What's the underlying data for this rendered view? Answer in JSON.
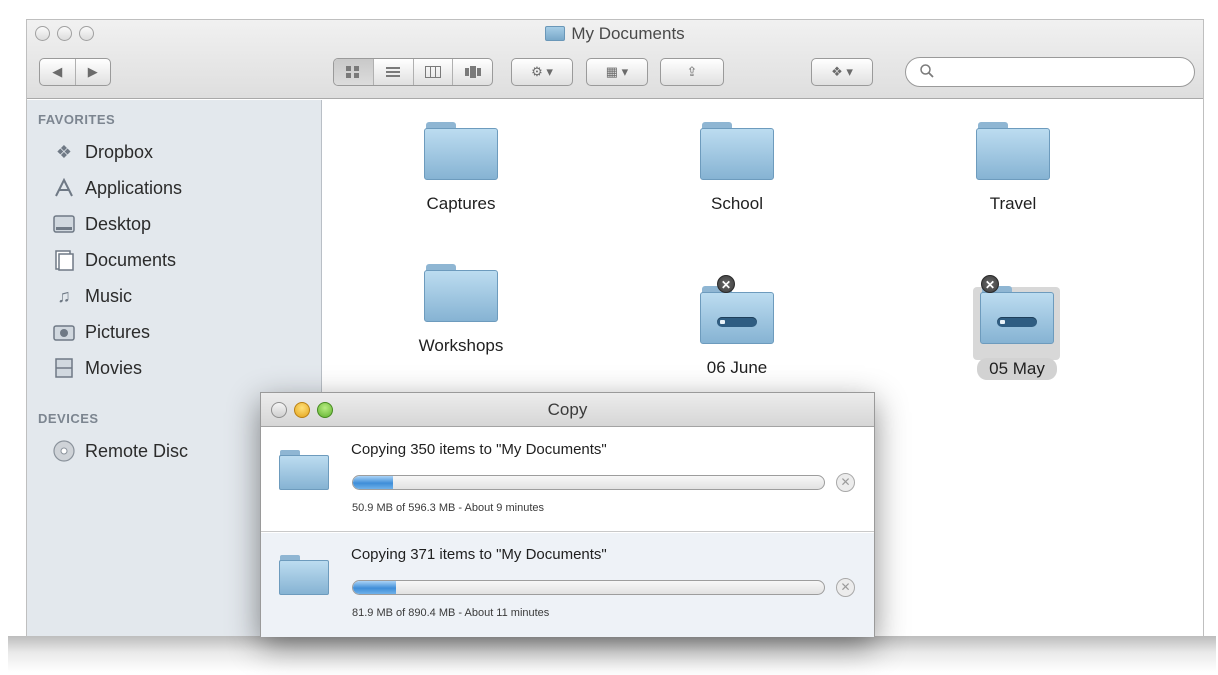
{
  "finder": {
    "title": "My Documents",
    "search": {
      "placeholder": ""
    },
    "toolbar": {
      "nav_back": "◀",
      "nav_forward": "▶",
      "views": [
        "icon-view",
        "list-view",
        "column-view",
        "coverflow-view"
      ],
      "action_label": "⚙ ▾",
      "arrange_label": "▦ ▾",
      "share_label": "⇪",
      "dropbox_label": "❖ ▾"
    }
  },
  "sidebar": {
    "favorites_header": "FAVORITES",
    "favorites": [
      {
        "label": "Dropbox",
        "icon": "dropbox-icon"
      },
      {
        "label": "Applications",
        "icon": "applications-icon"
      },
      {
        "label": "Desktop",
        "icon": "desktop-icon"
      },
      {
        "label": "Documents",
        "icon": "documents-icon"
      },
      {
        "label": "Music",
        "icon": "music-icon"
      },
      {
        "label": "Pictures",
        "icon": "pictures-icon"
      },
      {
        "label": "Movies",
        "icon": "movies-icon"
      }
    ],
    "devices_header": "DEVICES",
    "devices": [
      {
        "label": "Remote Disc",
        "icon": "remote-disc-icon"
      }
    ]
  },
  "files": [
    {
      "name": "Captures",
      "type": "folder"
    },
    {
      "name": "School",
      "type": "folder"
    },
    {
      "name": "Travel",
      "type": "folder"
    },
    {
      "name": "Workshops",
      "type": "folder"
    },
    {
      "name": "06 June",
      "type": "folder-copying"
    },
    {
      "name": "05 May",
      "type": "folder-copying",
      "selected": true
    }
  ],
  "copy_dialog": {
    "title": "Copy",
    "jobs": [
      {
        "label": "Copying 350 items to \"My Documents\"",
        "status": "50.9 MB of 596.3 MB - About 9 minutes",
        "progress": 0.085
      },
      {
        "label": "Copying 371 items to \"My Documents\"",
        "status": "81.9 MB of 890.4 MB - About 11 minutes",
        "progress": 0.092
      }
    ]
  },
  "colors": {
    "folder_blue": "#86b3d3",
    "progress_blue": "#3f8ed8",
    "sidebar_bg": "#e3e8ed"
  }
}
